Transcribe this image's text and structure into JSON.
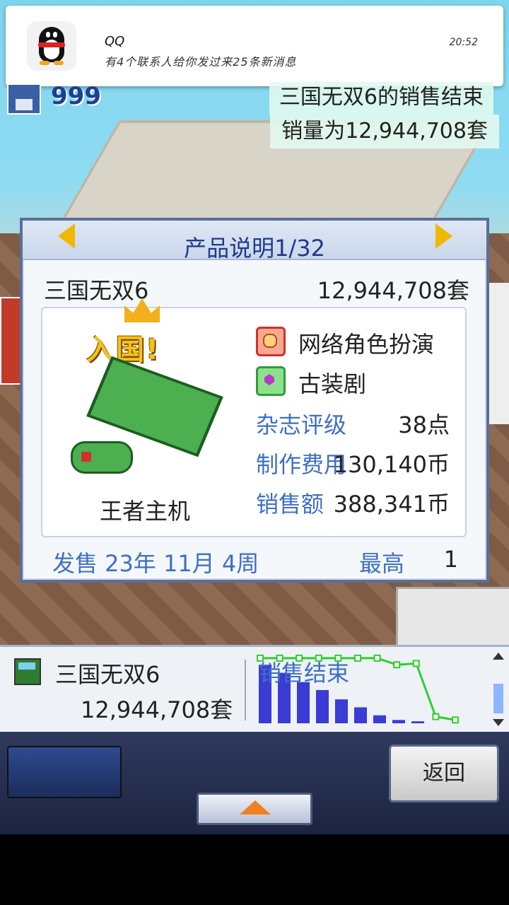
{
  "notification": {
    "app": "QQ",
    "message": "有4个联系人给你发过来25条新消息",
    "time": "20:52"
  },
  "hud": {
    "count": "999"
  },
  "banner": {
    "line1": "三国无双6的销售结束",
    "line2": "销量为12,944,708套"
  },
  "panel": {
    "title": "产品说明1/32",
    "game_name": "三国无双6",
    "units_sold": "12,944,708套",
    "hall_of_fame": "入国!",
    "platform": "王者主机",
    "genre": "网络角色扮演",
    "theme": "古装剧",
    "stats": {
      "magazine_label": "杂志评级",
      "magazine_value": "38点",
      "cost_label": "制作费用",
      "cost_value": "130,140币",
      "revenue_label": "销售额",
      "revenue_value": "388,341币"
    },
    "release": "发售 23年 11月 4周",
    "top_label": "最高",
    "top_value": "1"
  },
  "sales_bar": {
    "name": "三国无双6",
    "units": "12,944,708套",
    "chart_title": "销售结束"
  },
  "chart_data": {
    "type": "bar",
    "title": "销售结束",
    "bars": [
      88,
      76,
      62,
      50,
      36,
      24,
      12,
      5,
      3
    ],
    "rank_line": [
      98,
      98,
      98,
      98,
      98,
      98,
      98,
      88,
      90,
      10,
      5
    ],
    "ylim": [
      0,
      100
    ]
  },
  "controls": {
    "back_label": "返回"
  },
  "colors": {
    "panel_title": "#1e3a8a",
    "stat_label": "#3f6fc6",
    "bar_fill": "#3b3bd6",
    "line": "#2bd02b"
  }
}
